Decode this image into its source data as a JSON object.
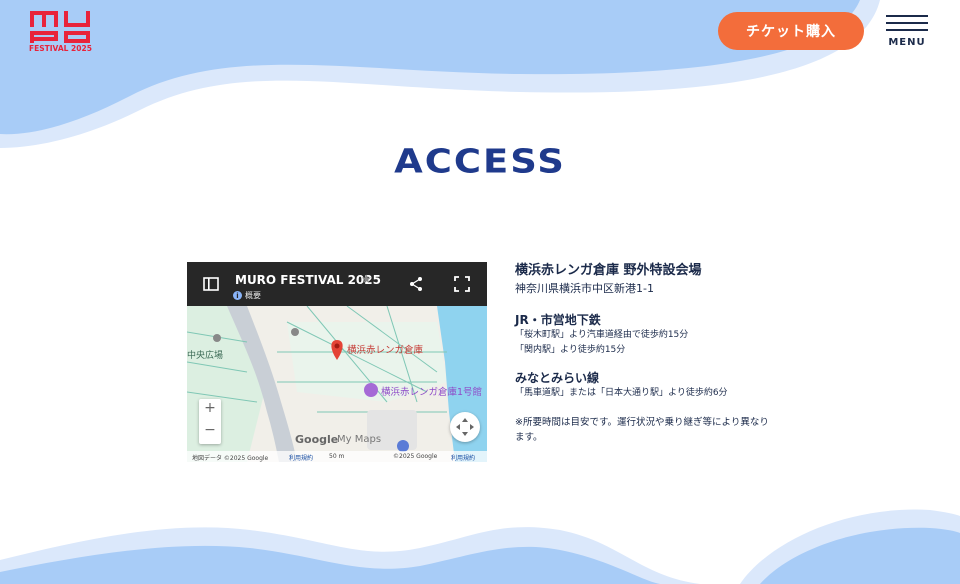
{
  "header": {
    "logo_text": "MURO",
    "logo_subtitle": "FESTIVAL 2025",
    "ticket_label": "チケット購入",
    "menu_label": "MENU"
  },
  "section": {
    "title": "ACCESS"
  },
  "map": {
    "title": "MURO FESTIVAL 2025",
    "overview_label": "概要",
    "places": [
      "中央広場",
      "横浜赤レンガ倉庫",
      "横浜赤レンガ倉庫1号館"
    ],
    "zoom_in": "+",
    "zoom_out": "−",
    "google_label": "Google",
    "mymaps_label": "My Maps",
    "footer": {
      "map_data": "地図データ ©2025 Google",
      "terms_left": "利用規約",
      "scale": "50 m",
      "copyright": "©2025 Google",
      "terms_right": "利用規約"
    }
  },
  "venue": {
    "name": "横浜赤レンガ倉庫 野外特設会場",
    "address": "神奈川県横浜市中区新港1-1"
  },
  "transit": [
    {
      "line": "JR・市営地下鉄",
      "routes": [
        "「桜木町駅」より汽車道経由で徒歩約15分",
        "「関内駅」より徒歩約15分"
      ]
    },
    {
      "line": "みなとみらい線",
      "routes": [
        "「馬車道駅」または「日本大通り駅」より徒歩約6分"
      ]
    }
  ],
  "note": "※所要時間は目安です。運行状況や乗り継ぎ等により異なります。",
  "colors": {
    "accent": "#f36d3b",
    "brand_red": "#e8233b",
    "title_blue": "#1f3a8c",
    "wave_blue": "#a8ccf7",
    "wave_light": "#dbe8fb",
    "text": "#1b2a4a"
  }
}
